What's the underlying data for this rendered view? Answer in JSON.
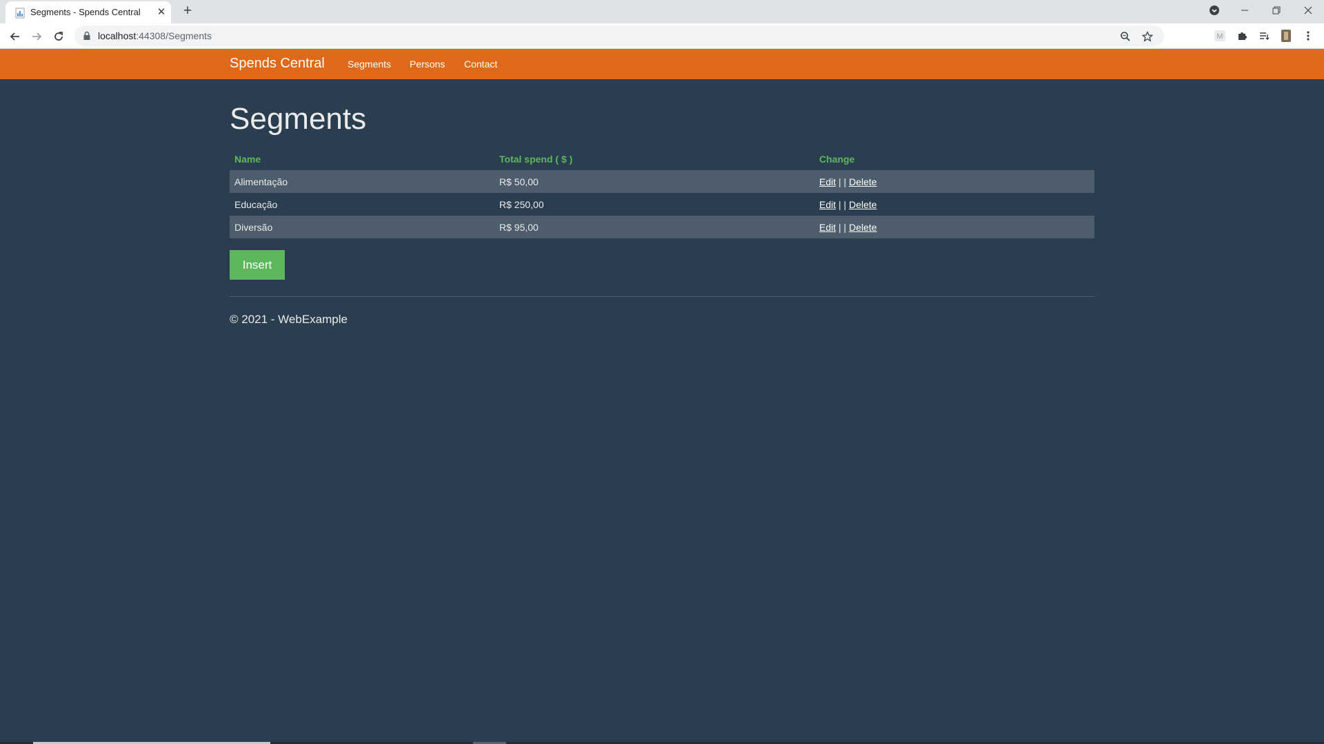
{
  "browser": {
    "tab_title": "Segments - Spends Central",
    "url_host": "localhost",
    "url_path": ":44308/Segments"
  },
  "site": {
    "brand": "Spends Central",
    "nav": [
      "Segments",
      "Persons",
      "Contact"
    ],
    "colors": {
      "navbar": "#df691a",
      "background": "#2b3e50",
      "accent": "#5cb85c",
      "row_alt": "#4e5d6c"
    }
  },
  "page": {
    "title": "Segments",
    "table": {
      "headers": [
        "Name",
        "Total spend ( $ )",
        "Change"
      ],
      "rows": [
        {
          "name": "Alimentação",
          "total": "R$ 50,00",
          "edit": "Edit",
          "sep": " | | ",
          "delete": "Delete"
        },
        {
          "name": "Educação",
          "total": "R$ 250,00",
          "edit": "Edit",
          "sep": " | | ",
          "delete": "Delete"
        },
        {
          "name": "Diversão",
          "total": "R$ 95,00",
          "edit": "Edit",
          "sep": " | | ",
          "delete": "Delete"
        }
      ]
    },
    "insert_label": "Insert",
    "footer": "© 2021 - WebExample"
  }
}
